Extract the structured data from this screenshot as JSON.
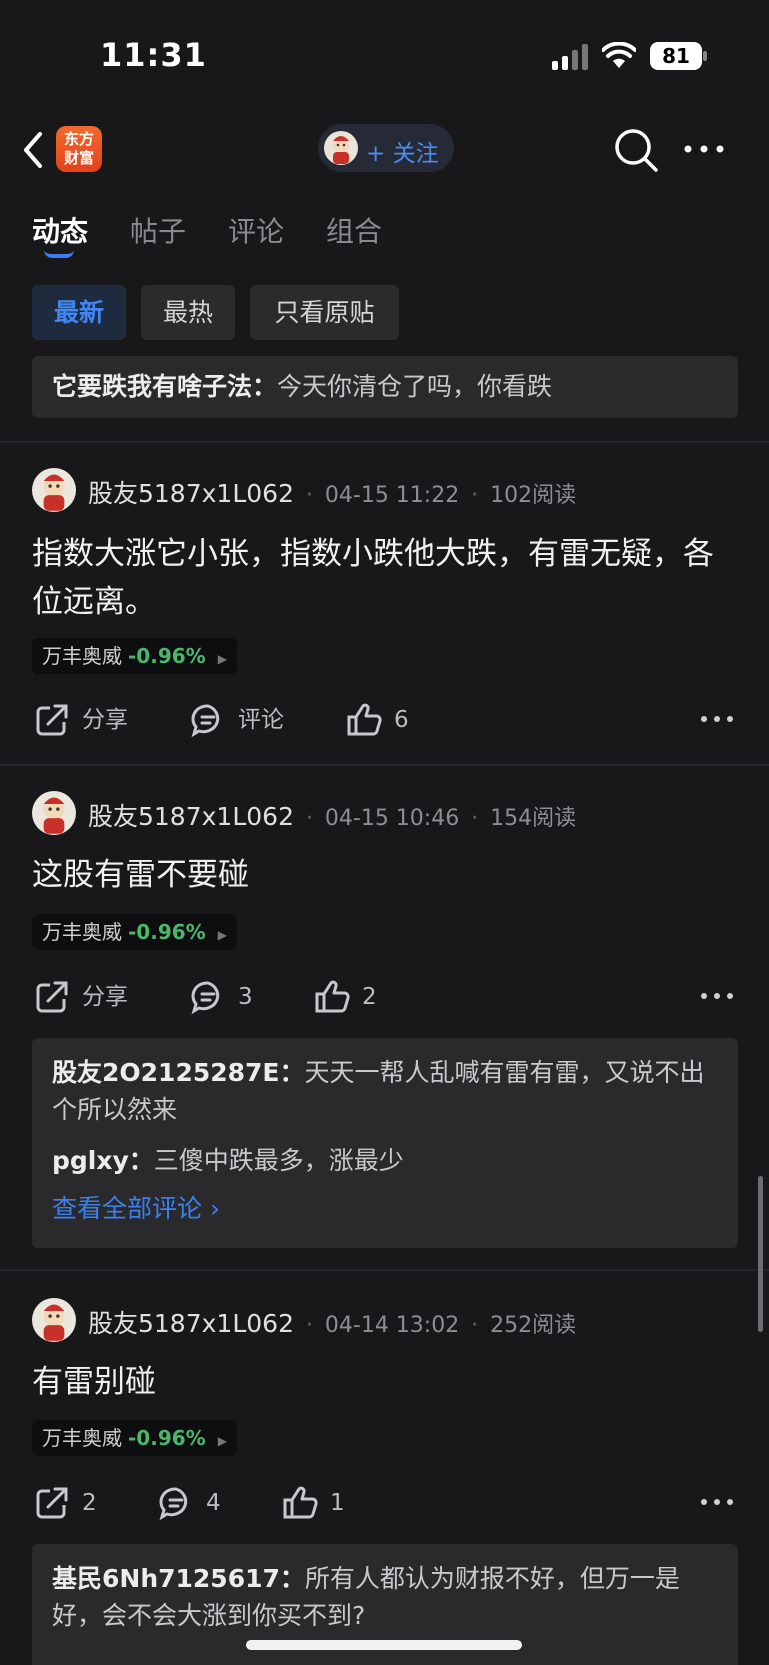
{
  "status": {
    "time": "11:31",
    "battery": "81"
  },
  "nav": {
    "logo_line1": "东方",
    "logo_line2": "财富",
    "follow_label": "+ 关注"
  },
  "tabs": [
    {
      "label": "动态"
    },
    {
      "label": "帖子"
    },
    {
      "label": "评论"
    },
    {
      "label": "组合"
    }
  ],
  "filters": [
    {
      "label": "最新"
    },
    {
      "label": "最热"
    },
    {
      "label": "只看原贴"
    }
  ],
  "top_reply": {
    "user": "它要跌我有啥子法：",
    "text": "今天你清仓了吗，你看跌"
  },
  "posts": [
    {
      "author": "股友5187x1L062",
      "date": "04-15 11:22",
      "reads": "102阅读",
      "text": "指数大涨它小张，指数小跌他大跌，有雷无疑，各位远离。",
      "stock": {
        "name": "万丰奥威",
        "change": "-0.96%"
      },
      "share_label": "分享",
      "comment_label": "评论",
      "like_count": "6"
    },
    {
      "author": "股友5187x1L062",
      "date": "04-15 10:46",
      "reads": "154阅读",
      "text": "这股有雷不要碰",
      "stock": {
        "name": "万丰奥威",
        "change": "-0.96%"
      },
      "share_label": "分享",
      "comment_label": "3",
      "like_count": "2",
      "replies": [
        {
          "user": "股友2O2125287E：",
          "text": "天天一帮人乱喊有雷有雷，又说不出个所以然来"
        },
        {
          "user": "pglxy：",
          "text": "三傻中跌最多，涨最少"
        }
      ],
      "view_all": "查看全部评论 ›"
    },
    {
      "author": "股友5187x1L062",
      "date": "04-14 13:02",
      "reads": "252阅读",
      "text": "有雷别碰",
      "stock": {
        "name": "万丰奥威",
        "change": "-0.96%"
      },
      "share_label": "2",
      "comment_label": "4",
      "like_count": "1",
      "replies": [
        {
          "user": "基民6Nh7125617：",
          "text": "所有人都认为财报不好，但万一是好，会不会大涨到你买不到?"
        }
      ]
    }
  ],
  "colors": {
    "accent": "#3b80ef",
    "down_green": "#4ab76b",
    "background": "#18181a"
  }
}
